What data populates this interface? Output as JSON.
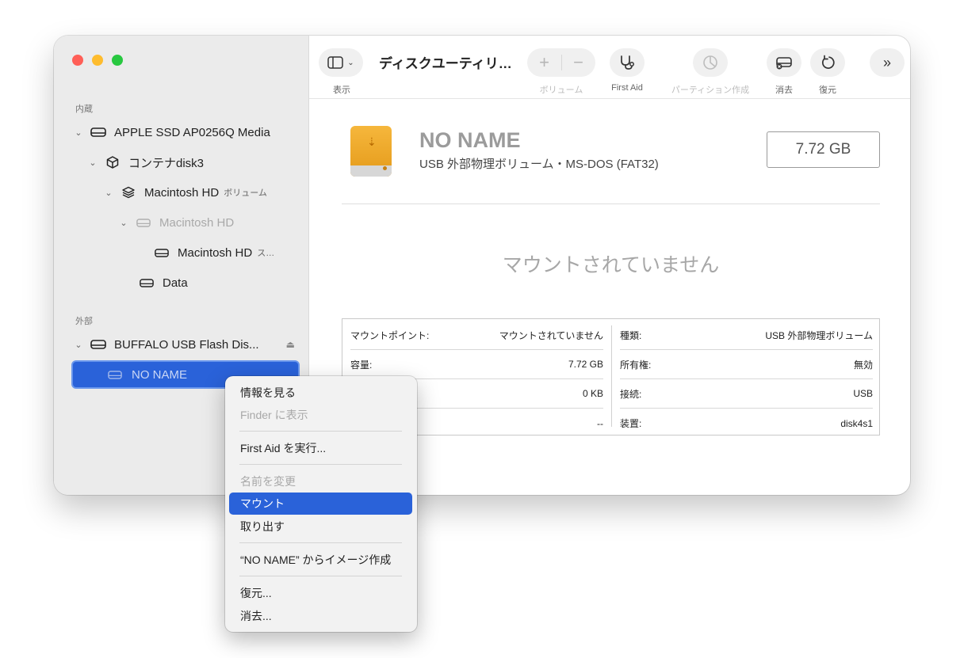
{
  "sidebar": {
    "sections": [
      {
        "label": "内蔵"
      },
      {
        "label": "外部"
      }
    ],
    "items": [
      {
        "label": "APPLE SSD AP0256Q Media",
        "sub": ""
      },
      {
        "label": "コンテナdisk3",
        "sub": ""
      },
      {
        "label": "Macintosh HD",
        "sub": "ボリューム"
      },
      {
        "label": "Macintosh HD",
        "sub": ""
      },
      {
        "label": "Macintosh HD",
        "sub": "ス…"
      },
      {
        "label": "Data",
        "sub": ""
      },
      {
        "label": "BUFFALO USB Flash Dis...",
        "sub": ""
      },
      {
        "label": "NO NAME",
        "sub": ""
      }
    ]
  },
  "toolbar": {
    "view_label": "表示",
    "title": "ディスクユーティリ…",
    "volume_label": "ボリューム",
    "first_aid_label": "First Aid",
    "partition_label": "パーティション作成",
    "erase_label": "消去",
    "restore_label": "復元"
  },
  "volume": {
    "name": "NO NAME",
    "description": "USB 外部物理ボリューム・MS-DOS (FAT32)",
    "size": "7.72 GB",
    "status": "マウントされていません"
  },
  "info": {
    "left": [
      {
        "key": "マウントポイント:",
        "value": "マウントされていません"
      },
      {
        "key": "容量:",
        "value": "7.72 GB"
      },
      {
        "key": "",
        "value": "0 KB"
      },
      {
        "key": "",
        "value": "--"
      }
    ],
    "right": [
      {
        "key": "種類:",
        "value": "USB 外部物理ボリューム"
      },
      {
        "key": "所有権:",
        "value": "無効"
      },
      {
        "key": "接続:",
        "value": "USB"
      },
      {
        "key": "装置:",
        "value": "disk4s1"
      }
    ]
  },
  "context_menu": {
    "items": [
      "情報を見る",
      "Finder に表示",
      "First Aid を実行...",
      "名前を変更",
      "マウント",
      "取り出す",
      "“NO NAME” からイメージ作成",
      "復元...",
      "消去..."
    ]
  },
  "colors": {
    "accent": "#2a62d9",
    "close": "#ff5f57",
    "minimize": "#febc2e",
    "zoom": "#28c840",
    "drive_icon": "#f0a82c"
  }
}
